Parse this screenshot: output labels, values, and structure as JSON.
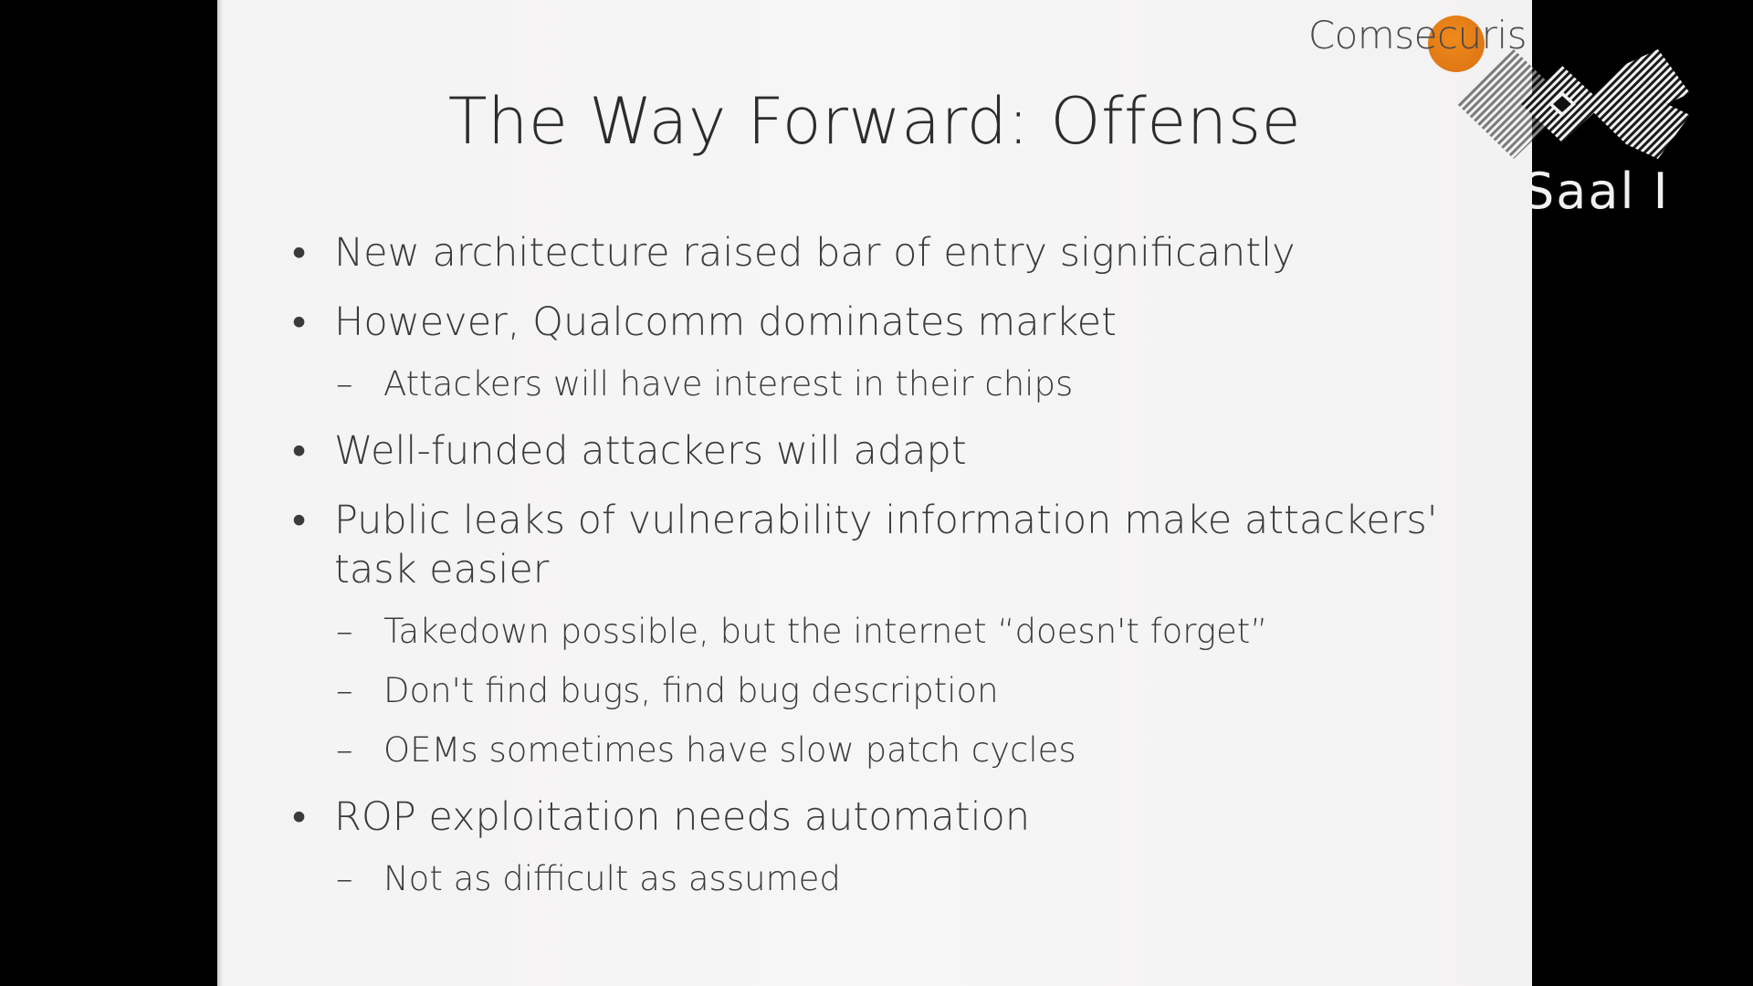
{
  "slide": {
    "title": "The Way Forward: Offense",
    "brand": "Comsecuris",
    "bullets": [
      {
        "level": 1,
        "text": "New architecture raised bar of entry significantly"
      },
      {
        "level": 1,
        "text": "However, Qualcomm dominates market"
      },
      {
        "level": 2,
        "text": "Attackers will have interest in their chips"
      },
      {
        "level": 1,
        "text": "Well-funded attackers will adapt"
      },
      {
        "level": 1,
        "text": "Public leaks of vulnerability information make attackers' task easier"
      },
      {
        "level": 2,
        "text": "Takedown possible, but the internet “doesn't forget”"
      },
      {
        "level": 2,
        "text": "Don't find bugs, find bug description"
      },
      {
        "level": 2,
        "text": "OEMs sometimes have slow patch cycles"
      },
      {
        "level": 1,
        "text": "ROP exploitation needs automation"
      },
      {
        "level": 2,
        "text": "Not as difficult as assumed"
      }
    ],
    "markers": {
      "l1": "•",
      "l2": "–"
    }
  },
  "overlay": {
    "room_label": "Saal I",
    "logo_icon": "ccc-logo-icon"
  },
  "colors": {
    "brand_orange": "#e8801a",
    "slide_bg": "#f5f4f4",
    "text": "#3a3a3a"
  }
}
